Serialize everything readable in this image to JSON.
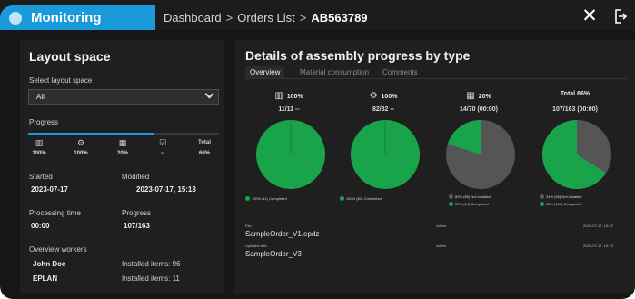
{
  "header": {
    "app_title": "Monitoring",
    "breadcrumb": [
      "Dashboard",
      "Orders List",
      "AB563789"
    ],
    "separator": ">"
  },
  "colors": {
    "accent": "#1a9ad8",
    "completed": "#19a44a",
    "remaining": "#555555"
  },
  "left_panel": {
    "title": "Layout space",
    "select_label": "Select layout space",
    "select_value": "All",
    "progress_label": "Progress",
    "progress_fraction": 0.66,
    "mini_stats": [
      {
        "icon": "building-icon",
        "glyph": "▥",
        "value": "100%"
      },
      {
        "icon": "gear-icon",
        "glyph": "⚙",
        "value": "100%"
      },
      {
        "icon": "panel-icon",
        "glyph": "▦",
        "value": "20%"
      },
      {
        "icon": "checkbox-icon",
        "glyph": "☑",
        "value": "--"
      },
      {
        "icon": "total",
        "glyph": "",
        "label": "Total",
        "value": "66%"
      }
    ],
    "started_label": "Started",
    "started_value": "2023-07-17",
    "modified_label": "Modified",
    "modified_value": "2023-07-17, 15:13",
    "processing_label": "Processing time",
    "processing_value": "00:00",
    "progress2_label": "Progress",
    "progress2_value": "107/163",
    "workers_label": "Overview workers",
    "workers": [
      {
        "name": "John Doe",
        "items": "Installed items: 96"
      },
      {
        "name": "EPLAN",
        "items": "Installed items: 11"
      }
    ]
  },
  "right_panel": {
    "title": "Details of assembly progress by type",
    "tabs": [
      "Overview",
      "Material consumption",
      "Comments"
    ],
    "active_tab": 0,
    "pies": [
      {
        "icon": "building-icon",
        "glyph": "▥",
        "header": "100%",
        "sub": "11/11 --",
        "completed_fraction": 1.0,
        "legend": [
          {
            "color": "#19a44a",
            "text": "100% (11) Completed"
          }
        ]
      },
      {
        "icon": "gear-icon",
        "glyph": "⚙",
        "header": "100%",
        "sub": "82/82 --",
        "completed_fraction": 1.0,
        "legend": [
          {
            "color": "#19a44a",
            "text": "100% (82) Completed"
          }
        ]
      },
      {
        "icon": "panel-icon",
        "glyph": "▦",
        "header": "20%",
        "sub": "14/70 (00:00)",
        "completed_fraction": 0.2,
        "legend": [
          {
            "color": "#5a5a5a",
            "text": "80% (56) Not installed"
          },
          {
            "color": "#19a44a",
            "text": "20% (14) Completed"
          }
        ]
      },
      {
        "icon": "total",
        "glyph": "",
        "header": "Total  66%",
        "sub": "107/163 (00:00)",
        "completed_fraction": 0.66,
        "legend": [
          {
            "color": "#5a5a5a",
            "text": "34% (56) Not installed"
          },
          {
            "color": "#19a44a",
            "text": "66% (107) Completed"
          }
        ]
      }
    ],
    "files": [
      {
        "label": "File:",
        "name": "SampleOrder_V1.epdz",
        "user": "Admin",
        "date": "2023-07-17, 15:10"
      },
      {
        "label": "Updated with:",
        "name": "SampleOrder_V3",
        "user": "Admin",
        "date": "2023-07-17, 15:13"
      }
    ]
  }
}
